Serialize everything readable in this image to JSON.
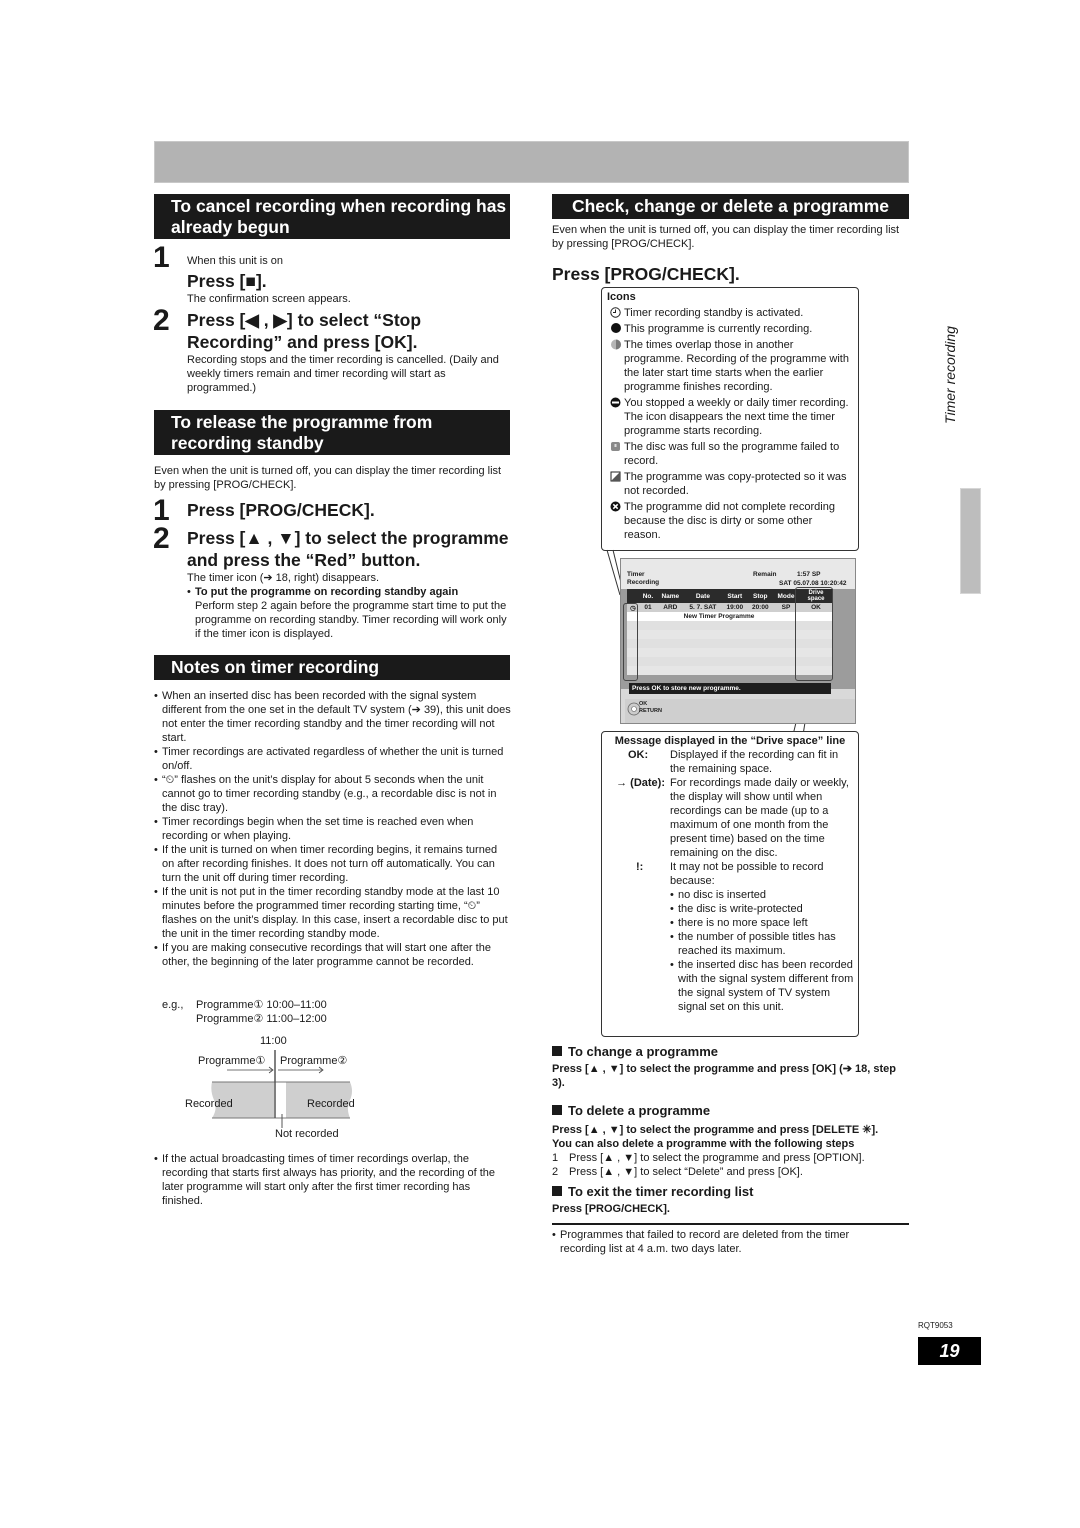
{
  "left": {
    "cancel_section": {
      "header": "To cancel recording when recording has already begun",
      "steps": [
        {
          "num": "1",
          "pre": "When this unit is on",
          "title": "Press [■].",
          "desc": "The confirmation screen appears."
        },
        {
          "num": "2",
          "title": "Press [◀ , ▶] to select “Stop Recording” and press [OK].",
          "desc": "Recording stops and the timer recording is cancelled. (Daily and weekly timers remain and timer recording will start as programmed.)"
        }
      ]
    },
    "release_section": {
      "header": "To release the programme from recording standby",
      "intro": "Even when the unit is turned off, you can display the timer recording list by pressing [PROG/CHECK].",
      "steps": [
        {
          "num": "1",
          "title": "Press [PROG/CHECK]."
        },
        {
          "num": "2",
          "title": "Press [▲ , ▼] to select the programme and press the “Red” button.",
          "desc": "The timer icon (➔ 18, right) disappears."
        }
      ],
      "bullet_title": "To put the programme on recording standby again",
      "bullet_text": "Perform step 2 again before the programme start time to put the programme on recording standby. Timer recording will work only if the timer icon is displayed."
    },
    "notes_section": {
      "header": "Notes on timer recording",
      "bullets": [
        "When an inserted disc has been recorded with the signal system different from the one set in the default TV system (➔ 39), this unit does not enter the timer recording standby and the timer recording will not start.",
        "Timer recordings are activated regardless of whether the unit is turned on/off.",
        "“⏲” flashes on the unit’s display for about 5 seconds when the unit cannot go to timer recording standby (e.g., a recordable disc is not in the disc tray).",
        "Timer recordings begin when the set time is reached even when recording or when playing.",
        "If the unit is turned on when timer recording begins, it remains turned on after recording finishes. It does not turn off automatically. You can turn the unit off during timer recording.",
        "If the unit is not put in the timer recording standby mode at the last 10 minutes before the programmed timer recording starting time, “⏲” flashes on the unit’s display. In this case, insert a recordable disc to put the unit in the timer recording standby mode.",
        "If you are making consecutive recordings that will start one after the other, the beginning of the later programme cannot be recorded."
      ],
      "example": {
        "label": "e.g.,",
        "line1": "Programme① 10:00–11:00",
        "line2": "Programme② 11:00–12:00"
      },
      "diagram": {
        "time": "11:00",
        "prog1": "Programme①",
        "prog2": "Programme②",
        "recorded_left": "Recorded",
        "recorded_right": "Recorded",
        "not_recorded": "Not recorded"
      },
      "last_bullet": "If the actual broadcasting times of timer recordings overlap, the recording that starts first always has priority, and the recording of the later programme will start only after the first timer recording has finished."
    }
  },
  "right": {
    "header": "Check, change or delete a programme",
    "intro": "Even when the unit is turned off, you can display the timer recording list by pressing [PROG/CHECK].",
    "press_title": "Press [PROG/CHECK].",
    "icons_box": {
      "title": "Icons",
      "items": [
        {
          "icon": "timer-standby",
          "text": "Timer recording standby is activated."
        },
        {
          "icon": "recording",
          "text": "This programme is currently recording."
        },
        {
          "icon": "overlap",
          "text": "The times overlap those in another programme. Recording of the programme with the later start time starts when the earlier programme finishes recording."
        },
        {
          "icon": "stopped",
          "text": "You stopped a weekly or daily timer recording. The icon disappears the next time the timer programme starts recording."
        },
        {
          "icon": "disc-full",
          "text": "The disc was full so the programme failed to record."
        },
        {
          "icon": "copy-protected",
          "text": "The programme was copy-protected so it was not recorded."
        },
        {
          "icon": "failed",
          "text": "The programme did not complete recording because the disc is dirty or some other reason."
        }
      ]
    },
    "screen": {
      "title1": "Timer",
      "title2": "Recording",
      "remain_label": "Remain",
      "remain_value": "1:57  SP",
      "datetime": "SAT 05.07.08 10:20:42",
      "columns": [
        "No.",
        "Name",
        "Date",
        "Start",
        "Stop",
        "Mode",
        "Drive space"
      ],
      "row": {
        "no": "01",
        "name": "ARD",
        "date": "5. 7. SAT",
        "start": "19:00",
        "stop": "20:00",
        "mode": "SP",
        "drive": "OK"
      },
      "new_row": "New Timer Programme",
      "status": "Press OK to store new programme.",
      "nav_ok": "OK",
      "nav_return": "RETURN"
    },
    "message_box": {
      "title": "Message displayed in the “Drive space” line",
      "items": [
        {
          "key": "OK:",
          "text": "Displayed if the recording can fit in the remaining space."
        },
        {
          "key": "→ (Date):",
          "text": "For recordings made daily or weekly, the display will show until when recordings can be made (up to a maximum of one month from the present time) based on the time remaining on the disc."
        },
        {
          "key": "!:",
          "text": "It may not be possible to record because:"
        }
      ],
      "reasons": [
        "no disc is inserted",
        "the disc is write-protected",
        "there is no more space left",
        "the number of possible titles has reached its maximum.",
        "the inserted disc has been recorded with the signal system different from the signal system of TV system signal set on this unit."
      ]
    },
    "change": {
      "title": "To change a programme",
      "text": "Press [▲ , ▼] to select the programme and press [OK] (➔ 18, step 3)."
    },
    "delete": {
      "title": "To delete a programme",
      "text1": "Press [▲ , ▼] to select the programme and press [DELETE ✳].",
      "text2": "You can also delete a programme with the following steps",
      "steps": [
        {
          "num": "1",
          "text": "Press [▲ , ▼] to select the programme and press [OPTION]."
        },
        {
          "num": "2",
          "text": "Press [▲ , ▼] to select “Delete” and press [OK]."
        }
      ]
    },
    "exit": {
      "title": "To exit the timer recording list",
      "text": "Press [PROG/CHECK]."
    },
    "footnote": "Programmes that failed to record are deleted from the timer recording list at 4 a.m. two days later."
  },
  "side_label": "Timer recording",
  "doc_code": "RQT9053",
  "page_number": "19"
}
